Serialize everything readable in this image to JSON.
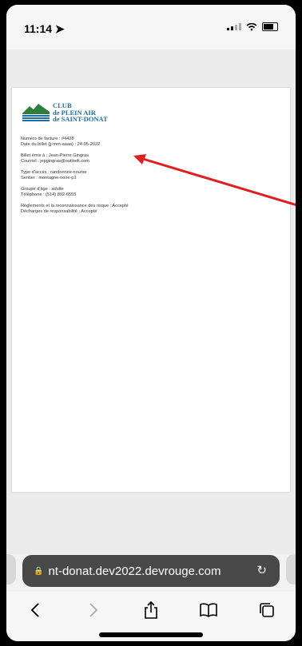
{
  "status_bar": {
    "time": "11:14"
  },
  "document": {
    "logo_lines": [
      "CLUB",
      "de PLEIN AIR",
      "de SAINT-DONAT"
    ],
    "fields": [
      [
        "Numéro de facture : #4428",
        "Date du billet (jj-mm-aaaa) : 24-05-2022"
      ],
      [
        "Billet émis à : Jean-Pierre Gingras",
        "Courriel : jepgingras@outlook.com"
      ],
      [
        "Type d'accès : randonnee-course",
        "Sentier : montagne-noire-p1"
      ],
      [
        "Groupe d'âge : adulte",
        "Téléphone : (514) 892-6555"
      ],
      [
        "Règlements et la reconnaissance des risque : Accepté",
        "Décharges de responsabilité : Accepté"
      ]
    ]
  },
  "browser": {
    "url": "nt-donat.dev2022.devrouge.com"
  },
  "colors": {
    "accent": "#1e6fa8",
    "annotation": "#e02020"
  }
}
